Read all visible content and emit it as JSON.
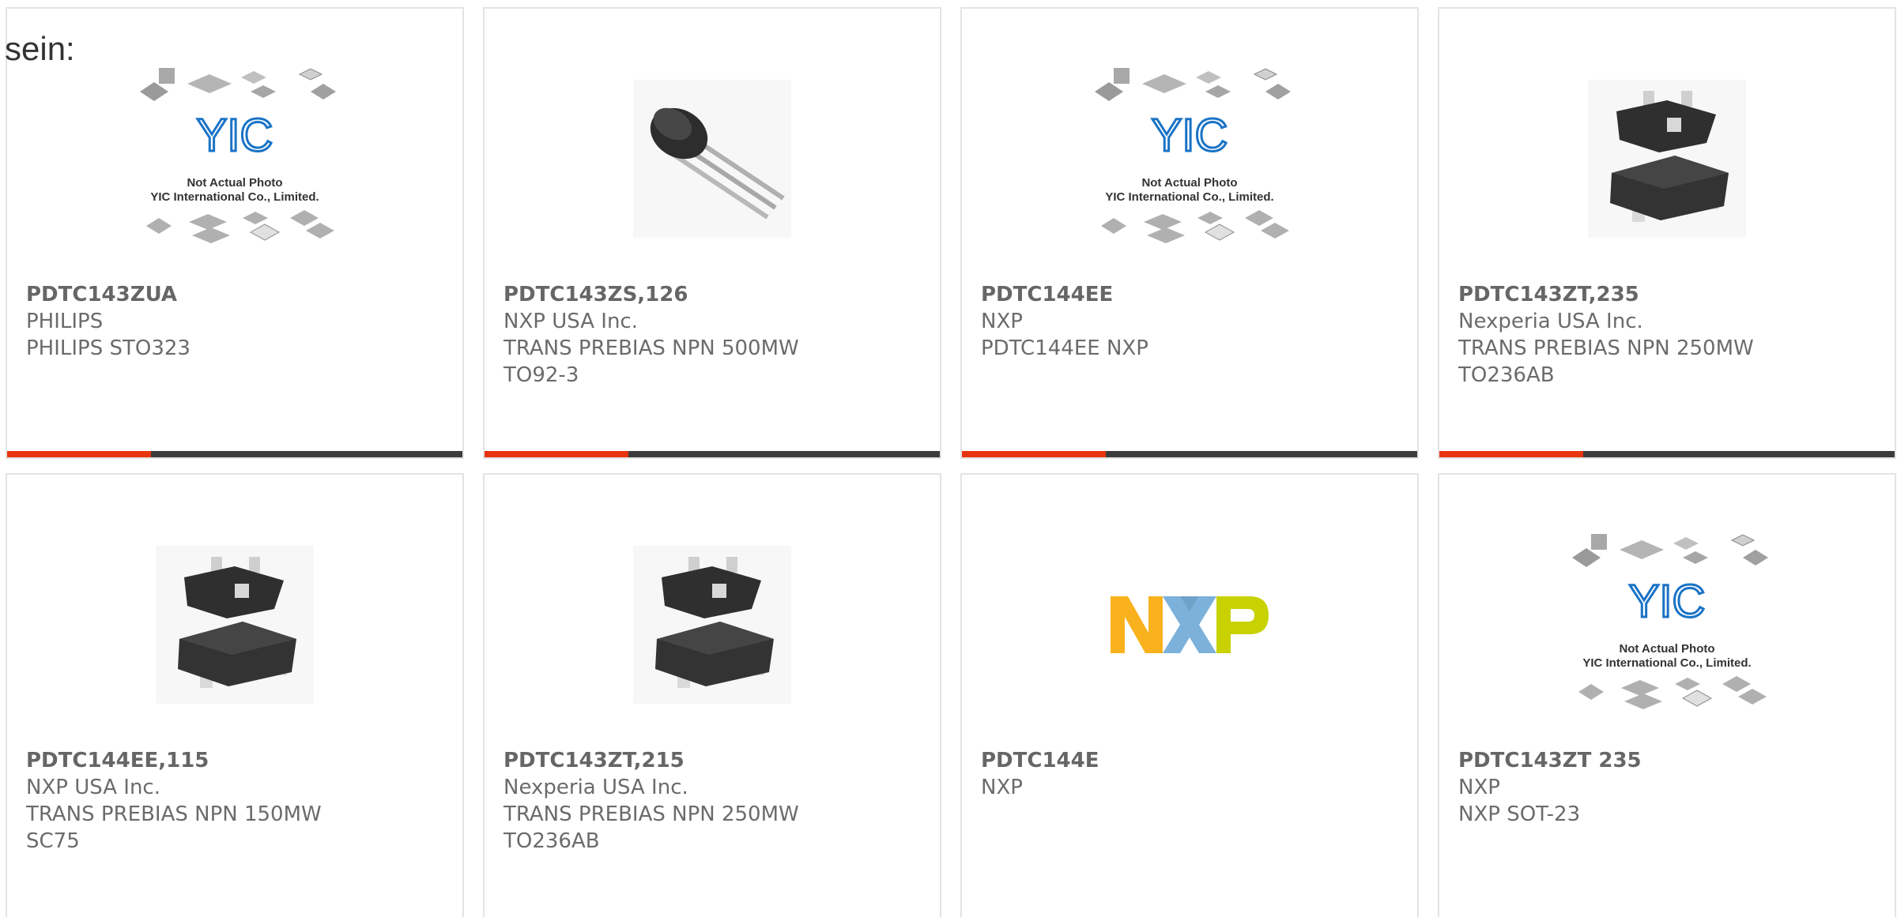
{
  "intro_text": "sein:",
  "products": [
    {
      "part": "PDTC143ZUA",
      "manufacturer": "PHILIPS",
      "description_lines": [
        "PHILIPS STO323"
      ],
      "image": "yic-placeholder",
      "placeholder_caption": [
        "Not Actual Photo",
        "YIC International Co., Limited."
      ]
    },
    {
      "part": "PDTC143ZS,126",
      "manufacturer": "NXP USA Inc.",
      "description_lines": [
        "TRANS PREBIAS NPN 500MW",
        "TO92-3"
      ],
      "image": "to92-transistor"
    },
    {
      "part": "PDTC144EE",
      "manufacturer": "NXP",
      "description_lines": [
        "PDTC144EE NXP"
      ],
      "image": "yic-placeholder",
      "placeholder_caption": [
        "Not Actual Photo",
        "YIC International Co., Limited."
      ]
    },
    {
      "part": "PDTC143ZT,235",
      "manufacturer": "Nexperia USA Inc.",
      "description_lines": [
        "TRANS PREBIAS NPN 250MW",
        "TO236AB"
      ],
      "image": "sot-transistor"
    },
    {
      "part": "PDTC144EE,115",
      "manufacturer": "NXP USA Inc.",
      "description_lines": [
        "TRANS PREBIAS NPN 150MW",
        "SC75"
      ],
      "image": "sot-transistor"
    },
    {
      "part": "PDTC143ZT,215",
      "manufacturer": "Nexperia USA Inc.",
      "description_lines": [
        "TRANS PREBIAS NPN 250MW",
        "TO236AB"
      ],
      "image": "sot-transistor"
    },
    {
      "part": "PDTC144E",
      "manufacturer": "NXP",
      "description_lines": [],
      "image": "nxp-logo"
    },
    {
      "part": "PDTC143ZT 235",
      "manufacturer": "NXP",
      "description_lines": [
        "NXP SOT-23"
      ],
      "image": "yic-placeholder",
      "placeholder_caption": [
        "Not Actual Photo",
        "YIC International Co., Limited."
      ]
    }
  ],
  "colors": {
    "accent_red": "#e8350f",
    "bar_dark": "#3c3c3c",
    "card_border": "#e3e3e3",
    "text_gray": "#6b6b6b"
  }
}
